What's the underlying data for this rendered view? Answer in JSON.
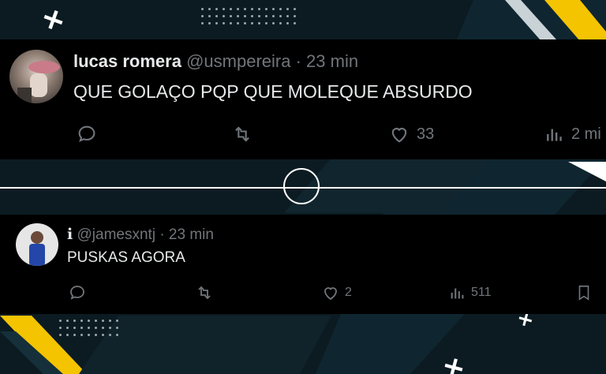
{
  "tweets": [
    {
      "name": "lucas romera",
      "handle": "@usmpereira",
      "time": "· 23 min",
      "text": "QUE GOLAÇO PQP QUE MOLEQUE ABSURDO",
      "likes": "33",
      "views": "2 mi"
    },
    {
      "name": "i",
      "handle": "@jamesxntj",
      "time": "· 23 min",
      "text": "PUSKAS AGORA",
      "likes": "2",
      "views": "511"
    }
  ],
  "icons": [
    "reply-icon",
    "retweet-icon",
    "like-icon",
    "views-icon",
    "bookmark-icon"
  ],
  "colors": {
    "background": "#0c1b22",
    "accent": "#f4c400",
    "tweet_bg": "#000000",
    "muted": "#71767b"
  }
}
